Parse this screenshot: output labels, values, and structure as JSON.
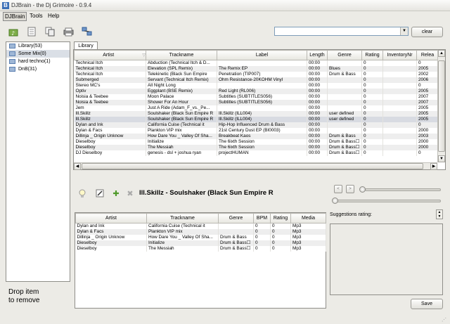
{
  "window": {
    "title": "DJBrain - the Dj Grimoire - 0.9.4"
  },
  "menu": [
    "DJBrain",
    "Tools",
    "Help"
  ],
  "toolbar": {
    "icons": [
      "import-music-icon",
      "document-icon",
      "copy-icon",
      "printer-icon",
      "network-icon"
    ],
    "search_value": "",
    "clear_label": "clear"
  },
  "sidebar": {
    "items": [
      {
        "label": "Library(53)",
        "icon": "library-icon"
      },
      {
        "label": "Some Mix(0)",
        "icon": "mix-icon"
      },
      {
        "label": "hard techno(1)",
        "icon": "mix-icon"
      },
      {
        "label": "DnB(31)",
        "icon": "mix-icon"
      }
    ],
    "drop_hint_line1": "Drop item",
    "drop_hint_line2": "to remove"
  },
  "library": {
    "tab_label": "Library",
    "columns": [
      "Artist",
      "Trackname",
      "Label",
      "Length",
      "Genre",
      "Rating",
      "InventoryNr",
      "Relea"
    ],
    "rows": [
      [
        "Technical Itch",
        "Abduction (Technical Itch & D...",
        "",
        "00:00",
        "",
        "0",
        "",
        "0"
      ],
      [
        "Technical Itch",
        "Elevation (SPL Remix)",
        "The Remix EP",
        "00:00",
        "Blues",
        "0",
        "",
        "2005"
      ],
      [
        "Technical Itch",
        "Telekinetic (Black Sun Empire",
        "Penetration (TIP007)",
        "00:00",
        "Drum & Bass",
        "0",
        "",
        "2002"
      ],
      [
        "Submerged",
        "Servant (Technical Itch Remix)",
        "Ohm Resistance-20KOHM Vinyl",
        "00:00",
        "",
        "0",
        "",
        "2006"
      ],
      [
        "Stereo MC's",
        "All Night Long",
        "",
        "00:00",
        "",
        "0",
        "",
        "0"
      ],
      [
        "Optiv",
        "Eggplant (BSE Remix)",
        "Red Light (RL006)",
        "00:00",
        "",
        "0",
        "",
        "2005"
      ],
      [
        "Noisia  & Teebee",
        "Moon Palace",
        "Subtitles (SUBTITLES056)",
        "00:00",
        "",
        "0",
        "",
        "2007"
      ],
      [
        "Noisia  & Teebee",
        "Shower For An Hour",
        "Subtitles (SUBTITLES056)",
        "00:00",
        "",
        "0",
        "",
        "2007"
      ],
      [
        "Jem",
        "Just A Ride (Adam_F_vs._Pe...",
        "",
        "00:00",
        "",
        "0",
        "",
        "2005"
      ],
      [
        "Ill.Skillz",
        "Soulshaker (Black Sun Empire R",
        "Ill.Skillz (ILL004)",
        "00:00",
        "user defined",
        "0",
        "",
        "2005"
      ],
      [
        "Ill.Skillz",
        "Soulshaker (Black Sun Empire R",
        "Ill.Skillz (ILL004)",
        "00:00",
        "user defined",
        "0",
        "",
        "2005"
      ],
      [
        "Dylan and Ink",
        "California Cuise (Technical it",
        "Hip-Hop Influenced Drum & Bass",
        "00:00",
        "",
        "0",
        "",
        "0"
      ],
      [
        "Dylan & Facs",
        "Plankton VIP mix",
        "21st Century Dust EP (BI0003)",
        "00:00",
        "",
        "0",
        "",
        "2000"
      ],
      [
        "Dillinja _ Origin Unknow",
        "How Dare You _ Valley Of Sha...",
        "Breakbeat Kaos",
        "00:00",
        "Drum & Bass",
        "0",
        "",
        "2003"
      ],
      [
        "Dieselboy",
        "Initialize",
        "The 6ixth Session",
        "00:00",
        "Drum & Bass☐",
        "0",
        "",
        "2000"
      ],
      [
        "Dieselboy",
        "The Messiah",
        "The 6ixth Session",
        "00:00",
        "Drum & Bass☐",
        "0",
        "",
        "2000"
      ],
      [
        "DJ Dieselboy",
        "genesis - dsl + joshua ryan",
        "projectHUMAN",
        "00:00",
        "Drum & Bass☐",
        "0",
        "",
        "0"
      ]
    ]
  },
  "player": {
    "now_playing": "Ill.Skillz - Soulshaker (Black Sun Empire R",
    "icons": [
      "lightbulb-icon",
      "edit-icon",
      "add-icon",
      "remove-icon"
    ],
    "prev_label": "<",
    "next_label": ">"
  },
  "playlist": {
    "columns": [
      "Artist",
      "Trackname",
      "Genre",
      "BPM",
      "Rating",
      "Media"
    ],
    "rows": [
      [
        "Dylan and Ink",
        "California Cuise (Technical it",
        "",
        "0",
        "0",
        "Mp3"
      ],
      [
        "Dylan & Facs",
        "Plankton VIP mix",
        "",
        "0",
        "0",
        "Mp3"
      ],
      [
        "Dillinja _ Origin Unknow",
        "How Dare You _ Valley Of Sha...",
        "Drum & Bass",
        "0",
        "0",
        "Mp3"
      ],
      [
        "Dieselboy",
        "Initialize",
        "Drum & Bass☐",
        "0",
        "0",
        "Mp3"
      ],
      [
        "Dieselboy",
        "The Messiah",
        "Drum & Bass☐",
        "0",
        "0",
        "Mp3"
      ]
    ]
  },
  "suggestions": {
    "label": "Suggestions rating:",
    "save_label": "Save"
  }
}
